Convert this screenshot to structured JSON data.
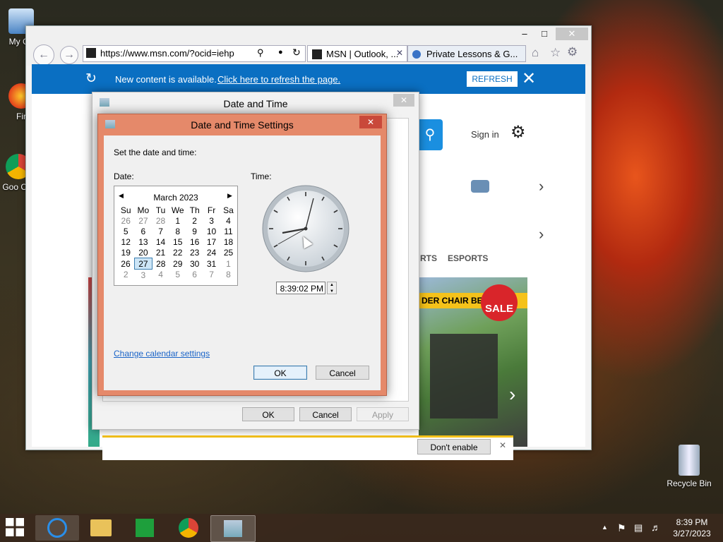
{
  "desktop": {
    "icons": [
      {
        "label": "My Co"
      },
      {
        "label": "Fir"
      },
      {
        "label": "Goo Chr"
      },
      {
        "label": "Recycle Bin"
      }
    ]
  },
  "browser": {
    "address": "https://www.msn.com/?ocid=iehp",
    "tabs": [
      {
        "label": "MSN | Outlook, ..."
      },
      {
        "label": "Private Lessons & G..."
      }
    ],
    "banner": {
      "text": "New content is available. ",
      "link": "Click here to refresh the page.",
      "button": "REFRESH"
    },
    "page": {
      "sign_in": "Sign in",
      "nav_partial_1": "RTS",
      "nav_partial_2": "ESPORTS",
      "ad_text": "DER CHAIR BENCH",
      "ad_badge": "SALE",
      "notify_button": "Don't enable"
    }
  },
  "dialog_outer": {
    "title": "Date and Time",
    "ok": "OK",
    "cancel": "Cancel",
    "apply": "Apply"
  },
  "dialog_settings": {
    "title": "Date and Time Settings",
    "instruction": "Set the date and time:",
    "date_label": "Date:",
    "time_label": "Time:",
    "month_title": "March 2023",
    "weekdays": [
      "Su",
      "Mo",
      "Tu",
      "We",
      "Th",
      "Fr",
      "Sa"
    ],
    "time_value": "8:39:02 PM",
    "change_calendar_link": "Change calendar settings",
    "ok": "OK",
    "cancel": "Cancel"
  },
  "taskbar": {
    "time": "8:39 PM",
    "date": "3/27/2023"
  }
}
